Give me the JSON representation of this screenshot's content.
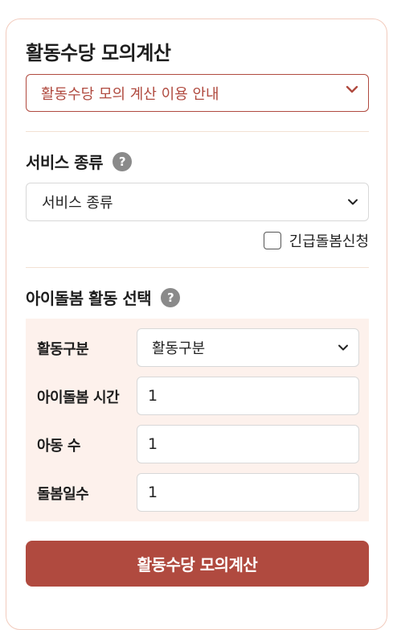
{
  "page": {
    "title": "활동수당 모의계산",
    "notice_label": "활동수당 모의 계산 이용 안내"
  },
  "service": {
    "section_title": "서비스 종류",
    "help_glyph": "?",
    "select_value": "서비스 종류",
    "emergency_label": "긴급돌봄신청",
    "emergency_checked": false
  },
  "activity": {
    "section_title": "아이돌봄 활동 선택",
    "help_glyph": "?",
    "fields": {
      "type_label": "활동구분",
      "type_value": "활동구분",
      "hours_label": "아이돌봄 시간",
      "hours_value": "1",
      "children_label": "아동 수",
      "children_value": "1",
      "days_label": "돌봄일수",
      "days_value": "1"
    }
  },
  "submit_label": "활동수당 모의계산",
  "colors": {
    "accent": "#b04a3f",
    "panel_bg": "#fdf1ec",
    "card_border": "#f2cbbd",
    "divider": "#f3e1d3"
  }
}
